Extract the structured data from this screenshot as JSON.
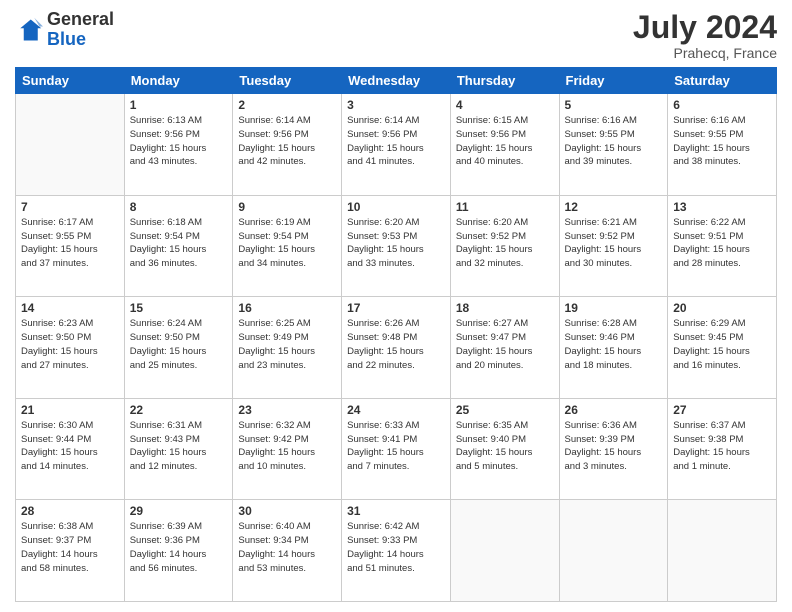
{
  "header": {
    "logo_general": "General",
    "logo_blue": "Blue",
    "month": "July 2024",
    "location": "Prahecq, France"
  },
  "weekdays": [
    "Sunday",
    "Monday",
    "Tuesday",
    "Wednesday",
    "Thursday",
    "Friday",
    "Saturday"
  ],
  "weeks": [
    [
      {
        "day": "",
        "info": ""
      },
      {
        "day": "1",
        "info": "Sunrise: 6:13 AM\nSunset: 9:56 PM\nDaylight: 15 hours\nand 43 minutes."
      },
      {
        "day": "2",
        "info": "Sunrise: 6:14 AM\nSunset: 9:56 PM\nDaylight: 15 hours\nand 42 minutes."
      },
      {
        "day": "3",
        "info": "Sunrise: 6:14 AM\nSunset: 9:56 PM\nDaylight: 15 hours\nand 41 minutes."
      },
      {
        "day": "4",
        "info": "Sunrise: 6:15 AM\nSunset: 9:56 PM\nDaylight: 15 hours\nand 40 minutes."
      },
      {
        "day": "5",
        "info": "Sunrise: 6:16 AM\nSunset: 9:55 PM\nDaylight: 15 hours\nand 39 minutes."
      },
      {
        "day": "6",
        "info": "Sunrise: 6:16 AM\nSunset: 9:55 PM\nDaylight: 15 hours\nand 38 minutes."
      }
    ],
    [
      {
        "day": "7",
        "info": "Sunrise: 6:17 AM\nSunset: 9:55 PM\nDaylight: 15 hours\nand 37 minutes."
      },
      {
        "day": "8",
        "info": "Sunrise: 6:18 AM\nSunset: 9:54 PM\nDaylight: 15 hours\nand 36 minutes."
      },
      {
        "day": "9",
        "info": "Sunrise: 6:19 AM\nSunset: 9:54 PM\nDaylight: 15 hours\nand 34 minutes."
      },
      {
        "day": "10",
        "info": "Sunrise: 6:20 AM\nSunset: 9:53 PM\nDaylight: 15 hours\nand 33 minutes."
      },
      {
        "day": "11",
        "info": "Sunrise: 6:20 AM\nSunset: 9:52 PM\nDaylight: 15 hours\nand 32 minutes."
      },
      {
        "day": "12",
        "info": "Sunrise: 6:21 AM\nSunset: 9:52 PM\nDaylight: 15 hours\nand 30 minutes."
      },
      {
        "day": "13",
        "info": "Sunrise: 6:22 AM\nSunset: 9:51 PM\nDaylight: 15 hours\nand 28 minutes."
      }
    ],
    [
      {
        "day": "14",
        "info": "Sunrise: 6:23 AM\nSunset: 9:50 PM\nDaylight: 15 hours\nand 27 minutes."
      },
      {
        "day": "15",
        "info": "Sunrise: 6:24 AM\nSunset: 9:50 PM\nDaylight: 15 hours\nand 25 minutes."
      },
      {
        "day": "16",
        "info": "Sunrise: 6:25 AM\nSunset: 9:49 PM\nDaylight: 15 hours\nand 23 minutes."
      },
      {
        "day": "17",
        "info": "Sunrise: 6:26 AM\nSunset: 9:48 PM\nDaylight: 15 hours\nand 22 minutes."
      },
      {
        "day": "18",
        "info": "Sunrise: 6:27 AM\nSunset: 9:47 PM\nDaylight: 15 hours\nand 20 minutes."
      },
      {
        "day": "19",
        "info": "Sunrise: 6:28 AM\nSunset: 9:46 PM\nDaylight: 15 hours\nand 18 minutes."
      },
      {
        "day": "20",
        "info": "Sunrise: 6:29 AM\nSunset: 9:45 PM\nDaylight: 15 hours\nand 16 minutes."
      }
    ],
    [
      {
        "day": "21",
        "info": "Sunrise: 6:30 AM\nSunset: 9:44 PM\nDaylight: 15 hours\nand 14 minutes."
      },
      {
        "day": "22",
        "info": "Sunrise: 6:31 AM\nSunset: 9:43 PM\nDaylight: 15 hours\nand 12 minutes."
      },
      {
        "day": "23",
        "info": "Sunrise: 6:32 AM\nSunset: 9:42 PM\nDaylight: 15 hours\nand 10 minutes."
      },
      {
        "day": "24",
        "info": "Sunrise: 6:33 AM\nSunset: 9:41 PM\nDaylight: 15 hours\nand 7 minutes."
      },
      {
        "day": "25",
        "info": "Sunrise: 6:35 AM\nSunset: 9:40 PM\nDaylight: 15 hours\nand 5 minutes."
      },
      {
        "day": "26",
        "info": "Sunrise: 6:36 AM\nSunset: 9:39 PM\nDaylight: 15 hours\nand 3 minutes."
      },
      {
        "day": "27",
        "info": "Sunrise: 6:37 AM\nSunset: 9:38 PM\nDaylight: 15 hours\nand 1 minute."
      }
    ],
    [
      {
        "day": "28",
        "info": "Sunrise: 6:38 AM\nSunset: 9:37 PM\nDaylight: 14 hours\nand 58 minutes."
      },
      {
        "day": "29",
        "info": "Sunrise: 6:39 AM\nSunset: 9:36 PM\nDaylight: 14 hours\nand 56 minutes."
      },
      {
        "day": "30",
        "info": "Sunrise: 6:40 AM\nSunset: 9:34 PM\nDaylight: 14 hours\nand 53 minutes."
      },
      {
        "day": "31",
        "info": "Sunrise: 6:42 AM\nSunset: 9:33 PM\nDaylight: 14 hours\nand 51 minutes."
      },
      {
        "day": "",
        "info": ""
      },
      {
        "day": "",
        "info": ""
      },
      {
        "day": "",
        "info": ""
      }
    ]
  ]
}
